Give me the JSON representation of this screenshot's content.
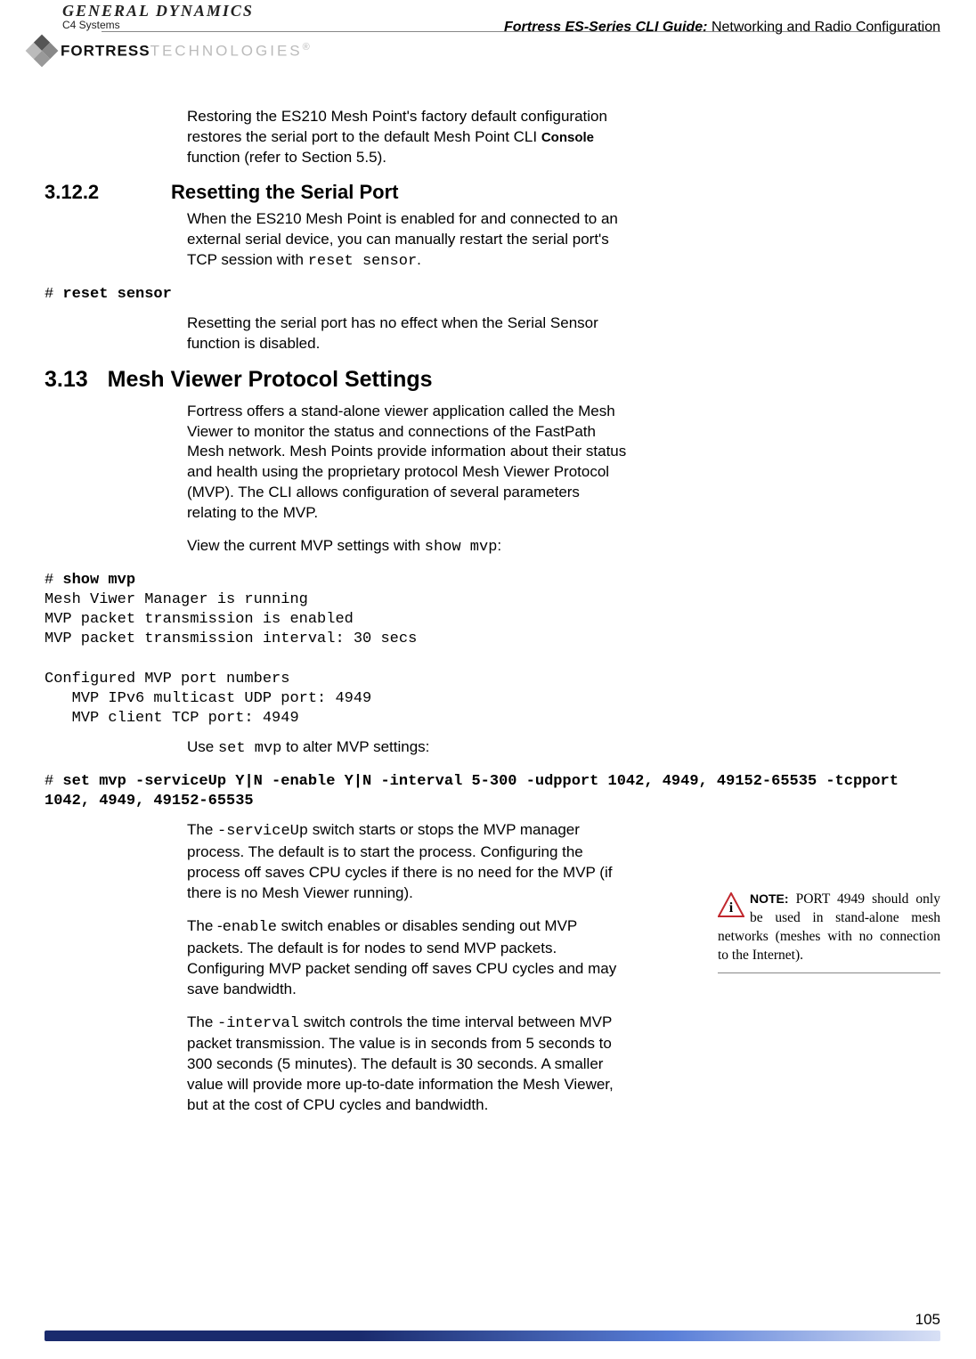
{
  "header": {
    "logo_main": "GENERAL DYNAMICS",
    "logo_sub": "C4 Systems",
    "guide_title_bold": "Fortress ES-Series CLI Guide:",
    "guide_title_rest": " Networking and Radio Configuration",
    "fortress_bold": "FORTRESS",
    "fortress_light": "TECHNOLOGIES",
    "reg": "®"
  },
  "intro_para": {
    "t1": "Restoring the ES210 Mesh Point's factory default configuration restores the serial port to the default Mesh Point CLI ",
    "console": "Console",
    "t2": " function (refer to Section 5.5)."
  },
  "sec_3_12_2": {
    "num": "3.12.2",
    "title": "Resetting the Serial Port",
    "p1a": "When the ES210 Mesh Point is enabled for and connected to an external serial device, you can manually restart the serial port's TCP session with ",
    "p1b": "reset sensor",
    "p1c": ".",
    "cli_prompt": "# ",
    "cli_cmd": "reset sensor",
    "p2": "Resetting the serial port has no effect when the Serial Sensor function is disabled."
  },
  "sec_3_13": {
    "num": "3.13",
    "title": "Mesh Viewer Protocol Settings",
    "p1": "Fortress offers a stand-alone viewer application called the Mesh Viewer to monitor the status and connections of the FastPath Mesh network. Mesh Points provide information about their status and health using the proprietary protocol Mesh Viewer Protocol (MVP). The CLI allows configuration of several parameters relating to the MVP.",
    "p2a": "View the current MVP settings with ",
    "p2b": "show mvp",
    "p2c": ":",
    "cli1_prompt": "# ",
    "cli1_cmd": "show mvp",
    "cli1_out": "Mesh Viwer Manager is running\nMVP packet transmission is enabled\nMVP packet transmission interval: 30 secs\n\nConfigured MVP port numbers\n   MVP IPv6 multicast UDP port: 4949\n   MVP client TCP port: 4949",
    "p3a": "Use ",
    "p3b": "set mvp",
    "p3c": " to alter MVP settings:",
    "cli2_prompt": "# ",
    "cli2_cmd": "set mvp -serviceUp Y|N -enable Y|N -interval 5-300 -udpport 1042, 4949, 49152-65535 -tcpport 1042, 4949, 49152-65535",
    "p4a": "The ",
    "p4b": "-serviceUp",
    "p4c": " switch starts or stops the MVP manager process. The default is to start the process. Configuring the process off saves CPU cycles if there is no need for the MVP (if there is no Mesh Viewer running).",
    "p5a": "The -",
    "p5b": "enable",
    "p5c": " switch enables or disables sending out MVP packets. The default is for nodes to send MVP packets. Configuring MVP packet sending off saves CPU cycles and may save bandwidth.",
    "p6a": "The ",
    "p6b": "-interval",
    "p6c": " switch controls the time interval between MVP packet transmission. The value is in seconds from 5 seconds to 300 seconds (5 minutes). The default is 30 seconds. A smaller value will provide more up-to-date information the Mesh Viewer, but at the cost of CPU cycles and bandwidth."
  },
  "note": {
    "label": "NOTE:",
    "text": " PORT 4949 should only be used in stand-alone mesh networks (meshes with no connection to the Internet)."
  },
  "page_number": "105"
}
